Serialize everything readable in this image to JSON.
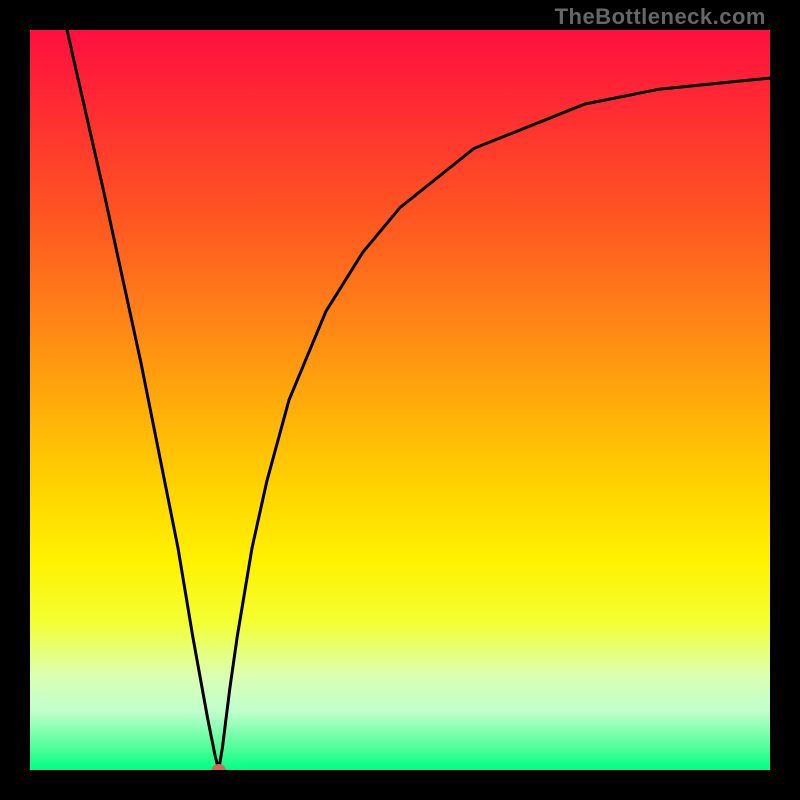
{
  "attribution": "TheBottleneck.com",
  "chart_data": {
    "type": "line",
    "title": "",
    "xlabel": "",
    "ylabel": "",
    "xlim": [
      0,
      100
    ],
    "ylim": [
      0,
      100
    ],
    "x": [
      5,
      10,
      15,
      20,
      22,
      24,
      25,
      25.5,
      26,
      27,
      28,
      30,
      32,
      35,
      40,
      45,
      50,
      55,
      60,
      65,
      70,
      75,
      80,
      85,
      90,
      95,
      100
    ],
    "values": [
      100,
      78,
      55,
      30,
      18,
      7,
      2,
      0,
      3,
      11,
      18,
      30,
      39,
      50,
      62,
      70,
      76,
      80,
      84,
      86,
      88,
      90,
      91,
      92,
      92.5,
      93,
      93.5
    ],
    "marker_point": {
      "x": 25.5,
      "y": 0
    },
    "gradient_stops": [
      {
        "offset": 0.0,
        "color": "#ff0f40"
      },
      {
        "offset": 0.12,
        "color": "#ff3030"
      },
      {
        "offset": 0.25,
        "color": "#ff5522"
      },
      {
        "offset": 0.38,
        "color": "#ff8018"
      },
      {
        "offset": 0.5,
        "color": "#ffaa0a"
      },
      {
        "offset": 0.62,
        "color": "#ffd400"
      },
      {
        "offset": 0.72,
        "color": "#fff200"
      },
      {
        "offset": 0.8,
        "color": "#f3ff33"
      },
      {
        "offset": 0.87,
        "color": "#ddffb0"
      },
      {
        "offset": 0.92,
        "color": "#c0ffcc"
      },
      {
        "offset": 0.97,
        "color": "#50ff9a"
      },
      {
        "offset": 1.0,
        "color": "#00ff85"
      }
    ]
  }
}
